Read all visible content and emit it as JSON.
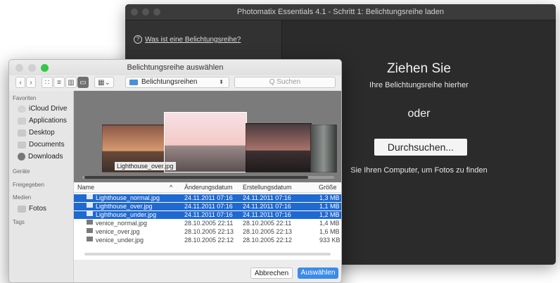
{
  "back_window": {
    "title": "Photomatix Essentials 4.1  -  Schritt 1: Belichtungsreihe laden",
    "help_link": "Was ist eine Belichtungsreihe?",
    "drop_title": "Ziehen Sie",
    "drop_subtitle": "Ihre Belichtungsreihe hierher",
    "or_text": "oder",
    "browse_button": "Durchsuchen...",
    "browse_hint": "Sie Ihren Computer, um Fotos zu finden"
  },
  "dialog": {
    "title": "Belichtungsreihe auswählen",
    "location": "Belichtungsreihen",
    "search_placeholder": "Q Suchen",
    "sidebar": {
      "favorites_header": "Favoriten",
      "favorites": [
        "iCloud Drive",
        "Applications",
        "Desktop",
        "Documents",
        "Downloads"
      ],
      "devices_header": "Geräte",
      "shared_header": "Freigegeben",
      "media_header": "Medien",
      "media": [
        "Fotos"
      ],
      "tags_header": "Tags"
    },
    "preview_caption": "Lighthouse_over.jpg",
    "columns": {
      "name": "Name",
      "modified": "Änderungsdatum",
      "created": "Erstellungsdatum",
      "size": "Größe"
    },
    "files": [
      {
        "name": "Lighthouse_normal.jpg",
        "modified": "24.11.2011 07:16",
        "created": "24.11.2011 07:16",
        "size": "1,3 MB",
        "selected": true
      },
      {
        "name": "Lighthouse_over.jpg",
        "modified": "24.11.2011 07:16",
        "created": "24.11.2011 07:16",
        "size": "1,1 MB",
        "selected": true
      },
      {
        "name": "Lighthouse_under.jpg",
        "modified": "24.11.2011 07:16",
        "created": "24.11.2011 07:16",
        "size": "1,2 MB",
        "selected": true
      },
      {
        "name": "venice_normal.jpg",
        "modified": "28.10.2005 22:11",
        "created": "28.10.2005 22:11",
        "size": "1,4 MB",
        "selected": false
      },
      {
        "name": "venice_over.jpg",
        "modified": "28.10.2005 22:13",
        "created": "28.10.2005 22:13",
        "size": "1,6 MB",
        "selected": false
      },
      {
        "name": "venice_under.jpg",
        "modified": "28.10.2005 22:12",
        "created": "28.10.2005 22:12",
        "size": "933 KB",
        "selected": false
      }
    ],
    "cancel_button": "Abbrechen",
    "confirm_button": "Auswählen"
  },
  "colors": {
    "selection": "#1f69d0",
    "accent_button": "#3b8be8",
    "dark_panel": "#2b2b2b"
  }
}
